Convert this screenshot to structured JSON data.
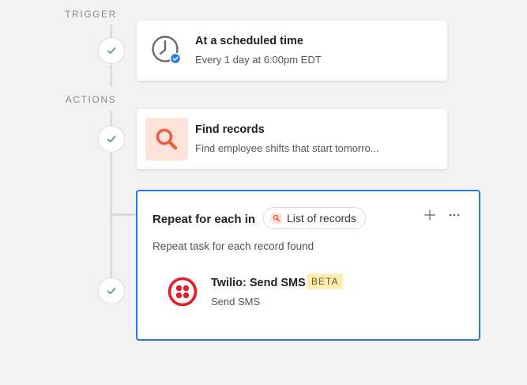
{
  "sections": {
    "trigger_label": "TRIGGER",
    "actions_label": "ACTIONS"
  },
  "trigger": {
    "title": "At a scheduled time",
    "subtitle": "Every 1 day at 6:00pm EDT",
    "icon": "clock-icon",
    "badge_icon": "check-badge-icon"
  },
  "find_records": {
    "title": "Find records",
    "subtitle": "Find employee shifts that start tomorro...",
    "icon": "search-icon",
    "icon_bg": "#fde3d9",
    "icon_color": "#e8603c"
  },
  "repeat": {
    "title": "Repeat for each in",
    "chip_label": "List of records",
    "description": "Repeat task for each record found",
    "border_color": "#2b7bde",
    "inner_action": {
      "title": "Twilio: Send SMS",
      "badge": "BETA",
      "subtitle": "Send SMS",
      "icon": "twilio-icon",
      "icon_color": "#e31e26"
    }
  },
  "colors": {
    "check": "#3aa35f",
    "rail": "#dcdcdc"
  }
}
